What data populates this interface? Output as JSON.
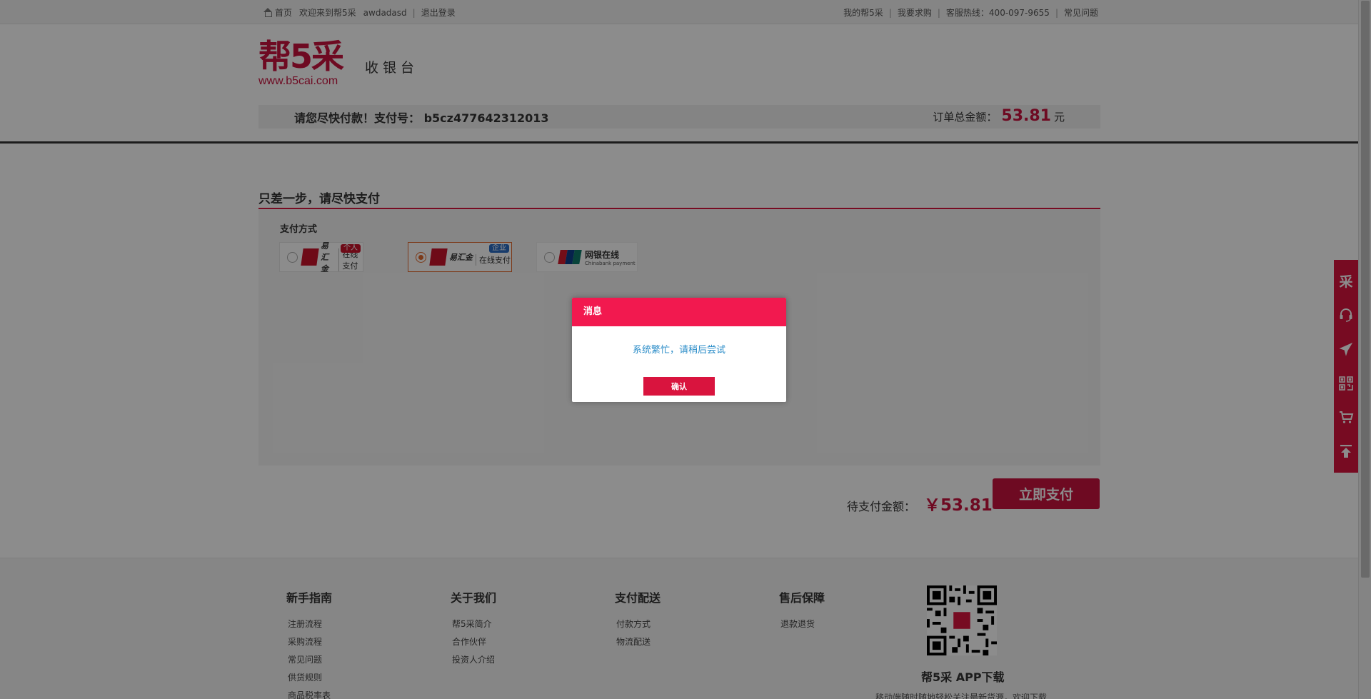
{
  "topbar": {
    "home": "首页",
    "welcome": "欢迎来到帮5采",
    "username": "awdadasd",
    "logout": "退出登录",
    "my_account": "我的帮5采",
    "want_buy": "我要求购",
    "hotline": "客服热线：400-097-9655",
    "faq": "常见问题"
  },
  "header": {
    "logo_text": "帮5采",
    "logo_url": "www.b5cai.com",
    "cashier": "收银台"
  },
  "order": {
    "message": "请您尽快付款！支付号： b5cz477642312013",
    "total_label": "订单总金额：",
    "total_value": "53.81",
    "total_unit": "元"
  },
  "main": {
    "step_title": "只差一步，请尽快支付",
    "pay_method_label": "支付方式",
    "options": [
      {
        "brand": "易汇金",
        "online": "在线支付",
        "tag": "个人",
        "tag_color": "#c8132a",
        "selected": false
      },
      {
        "brand": "易汇金",
        "online": "在线支付",
        "tag": "企业",
        "tag_color": "#2b6cc4",
        "selected": true
      },
      {
        "brand": "网银在线",
        "sub": "Chinabank payment",
        "selected": false
      }
    ],
    "due_label": "待支付金额：",
    "due_value": "￥53.81",
    "pay_button": "立即支付"
  },
  "footer": {
    "cols": [
      {
        "title": "新手指南",
        "items": [
          "注册流程",
          "采购流程",
          "常见问题",
          "供货规则",
          "商品税率表"
        ]
      },
      {
        "title": "关于我们",
        "items": [
          "帮5采简介",
          "合作伙伴",
          "投资人介绍"
        ]
      },
      {
        "title": "支付配送",
        "items": [
          "付款方式",
          "物流配送"
        ]
      },
      {
        "title": "售后保障",
        "items": [
          "退款退货"
        ]
      }
    ],
    "app_title": "帮5采 APP下载",
    "app_sub": "移动端随时随地轻松关注最新货源，欢迎下载"
  },
  "floatbar": {
    "icons": [
      "cai-logo-icon",
      "headset-icon",
      "plane-icon",
      "qrcode-icon",
      "cart-icon",
      "back-to-top-icon"
    ],
    "logo_char": "采"
  },
  "dialog": {
    "title": "消息",
    "message": "系统繁忙，请稍后尝试",
    "confirm": "确认"
  },
  "colors": {
    "brand": "#c8133f",
    "dialog_header": "#f2194f",
    "message_text": "#2a8cc8"
  }
}
